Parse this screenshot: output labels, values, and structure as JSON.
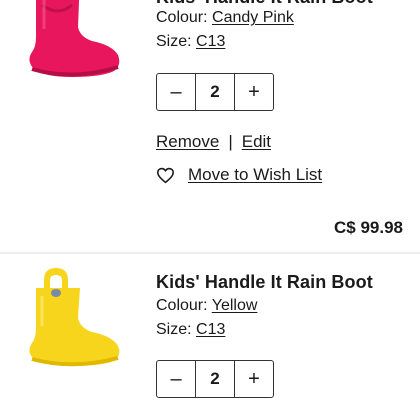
{
  "cart_items": [
    {
      "title": "Kids' Handle It Rain Boot",
      "colour_label": "Colour:",
      "colour_value": "Candy Pink",
      "size_label": "Size:",
      "size_value": "C13",
      "quantity": "2",
      "decrement": "–",
      "increment": "+",
      "remove_label": "Remove",
      "separator": "|",
      "edit_label": "Edit",
      "wishlist_label": "Move to Wish List",
      "price": "C$ 99.98",
      "image_icon": "pink-rain-boot-image",
      "boot_color": "#e8175d"
    },
    {
      "title": "Kids' Handle It Rain Boot",
      "colour_label": "Colour:",
      "colour_value": "Yellow",
      "size_label": "Size:",
      "size_value": "C13",
      "quantity": "2",
      "decrement": "–",
      "increment": "+",
      "image_icon": "yellow-rain-boot-image",
      "boot_color": "#f7d51d"
    }
  ]
}
